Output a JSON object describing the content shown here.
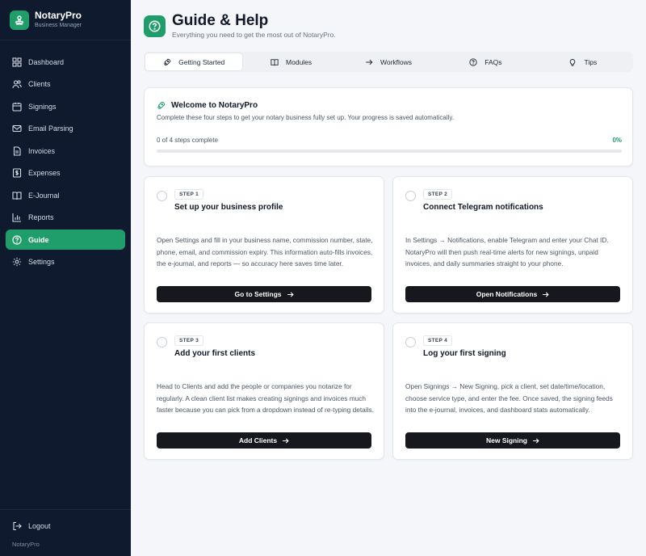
{
  "brand": {
    "name": "NotaryPro",
    "subtitle": "Business Manager"
  },
  "sidebar": {
    "items": [
      {
        "label": "Dashboard",
        "icon": "dashboard-icon",
        "active": false
      },
      {
        "label": "Clients",
        "icon": "users-icon",
        "active": false
      },
      {
        "label": "Signings",
        "icon": "calendar-icon",
        "active": false
      },
      {
        "label": "Email Parsing",
        "icon": "mail-icon",
        "active": false
      },
      {
        "label": "Invoices",
        "icon": "invoice-icon",
        "active": false
      },
      {
        "label": "Expenses",
        "icon": "dollar-icon",
        "active": false
      },
      {
        "label": "E-Journal",
        "icon": "book-icon",
        "active": false
      },
      {
        "label": "Reports",
        "icon": "bar-chart-icon",
        "active": false
      },
      {
        "label": "Guide",
        "icon": "help-circle-icon",
        "active": true
      },
      {
        "label": "Settings",
        "icon": "gear-icon",
        "active": false
      }
    ],
    "logout_label": "Logout",
    "footer_text": "NotaryPro"
  },
  "header": {
    "title": "Guide & Help",
    "subtitle": "Everything you need to get the most out of NotaryPro."
  },
  "tabs": [
    {
      "label": "Getting Started",
      "icon": "rocket-icon",
      "active": true
    },
    {
      "label": "Modules",
      "icon": "book-open-icon",
      "active": false
    },
    {
      "label": "Workflows",
      "icon": "arrow-right-icon",
      "active": false
    },
    {
      "label": "FAQs",
      "icon": "question-icon",
      "active": false
    },
    {
      "label": "Tips",
      "icon": "lightbulb-icon",
      "active": false
    }
  ],
  "welcome": {
    "title": "Welcome to NotaryPro",
    "description": "Complete these four steps to get your notary business fully set up. Your progress is saved automatically.",
    "progress_label": "0 of 4 steps complete",
    "progress_percent_label": "0%",
    "progress_fraction": 0
  },
  "steps": [
    {
      "badge": "STEP 1",
      "title": "Set up your business profile",
      "description": "Open Settings and fill in your business name, commission number, state, phone, email, and commission expiry. This information auto-fills invoices, the e-journal, and reports — so accuracy here saves time later.",
      "button": "Go to Settings"
    },
    {
      "badge": "STEP 2",
      "title": "Connect Telegram notifications",
      "description": "In Settings → Notifications, enable Telegram and enter your Chat ID. NotaryPro will then push real-time alerts for new signings, unpaid invoices, and daily summaries straight to your phone.",
      "button": "Open Notifications"
    },
    {
      "badge": "STEP 3",
      "title": "Add your first clients",
      "description": "Head to Clients and add the people or companies you notarize for regularly. A clean client list makes creating signings and invoices much faster because you can pick from a dropdown instead of re-typing details.",
      "button": "Add Clients"
    },
    {
      "badge": "STEP 4",
      "title": "Log your first signing",
      "description": "Open Signings → New Signing, pick a client, set date/time/location, choose service type, and enter the fee. Once saved, the signing feeds into the e-journal, invoices, and dashboard stats automatically.",
      "button": "New Signing"
    }
  ],
  "colors": {
    "accent": "#1f9d6b",
    "sidebar_bg": "#0f1a2e",
    "button_dark": "#16181d"
  }
}
